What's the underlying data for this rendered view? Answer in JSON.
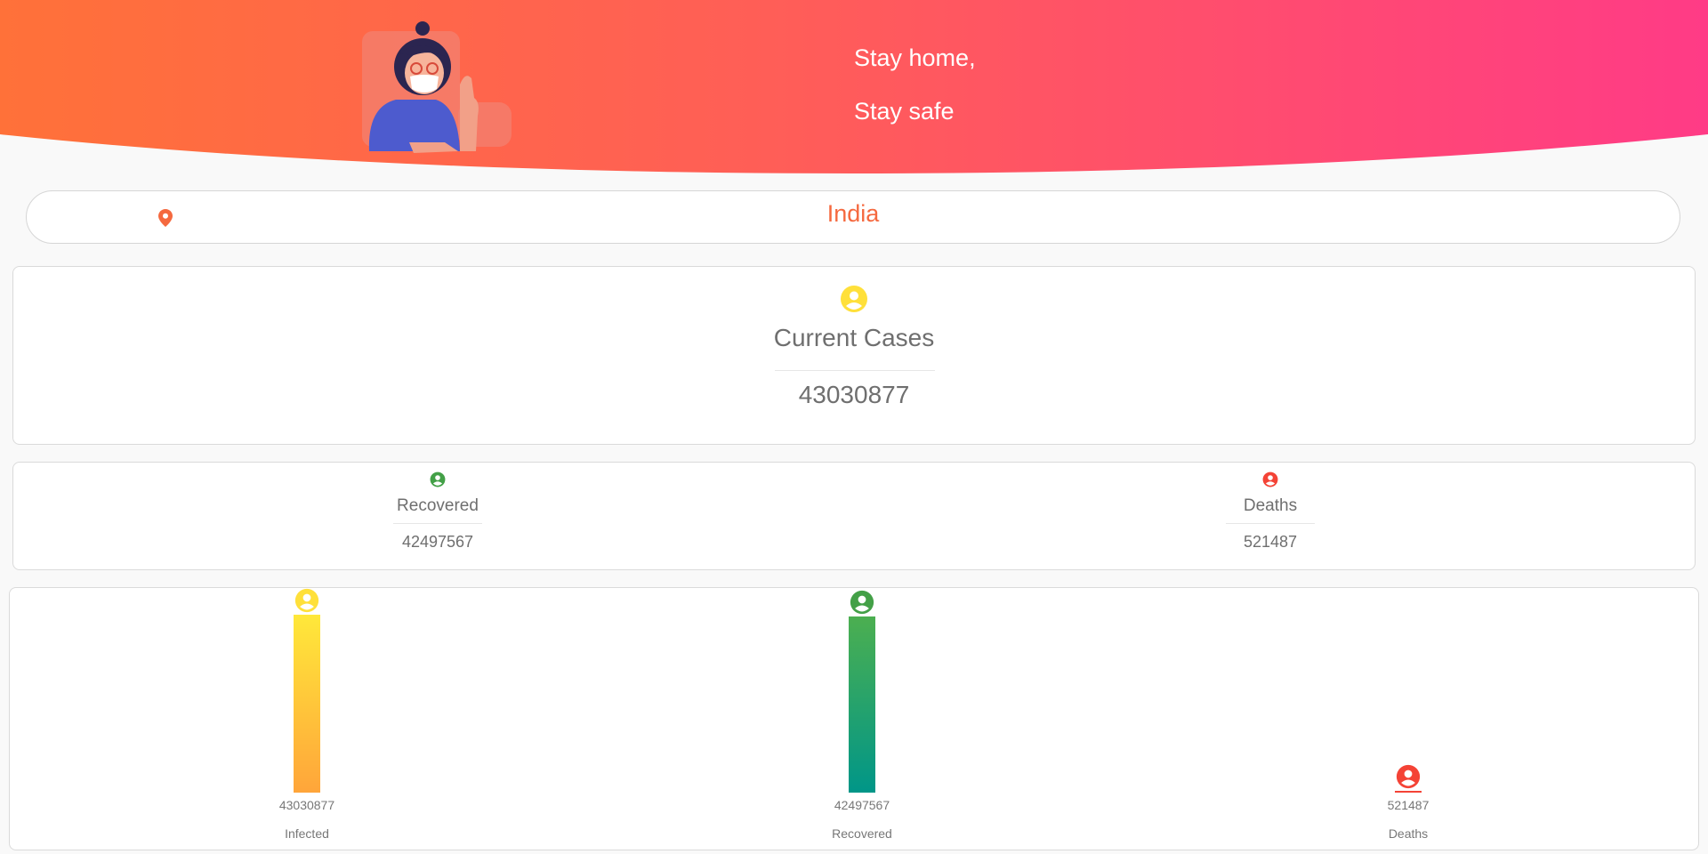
{
  "header": {
    "slogan_line1": "Stay home,",
    "slogan_line2": "Stay safe",
    "gradient_start": "#ff7139",
    "gradient_end": "#ff3b86"
  },
  "location": {
    "icon": "map-pin-icon",
    "country": "India",
    "accent": "#f5693f"
  },
  "current": {
    "icon": "person-circle-icon",
    "icon_color": "#ffe03a",
    "title": "Current Cases",
    "value": "43030877"
  },
  "stats": {
    "recovered": {
      "icon": "person-circle-icon",
      "color": "#43a047",
      "label": "Recovered",
      "value": "42497567"
    },
    "deaths": {
      "icon": "person-circle-icon",
      "color": "#f44336",
      "label": "Deaths",
      "value": "521487"
    }
  },
  "chart_data": {
    "type": "bar",
    "categories": [
      "Infected",
      "Recovered",
      "Deaths"
    ],
    "values": [
      43030877,
      42497567,
      521487
    ],
    "value_labels": [
      "43030877",
      "42497567",
      "521487"
    ],
    "colors": [
      [
        "#ffe83a",
        "#ffa53a"
      ],
      [
        "#4caf50",
        "#009688"
      ],
      [
        "#f44336",
        "#f44336"
      ]
    ],
    "title": "",
    "xlabel": "",
    "ylabel": ""
  }
}
